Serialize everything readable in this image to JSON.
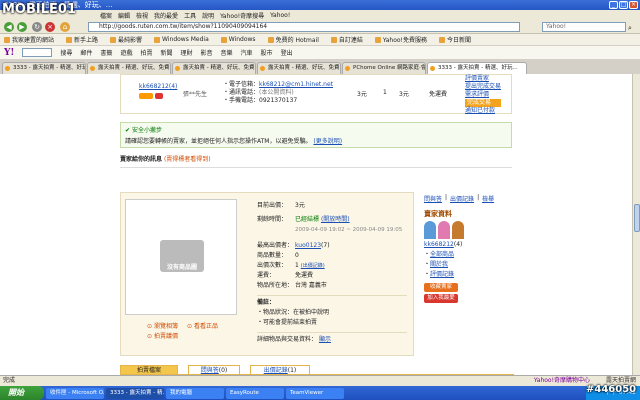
{
  "window": {
    "title": "3333 - 露天拍賣 - 精選、好玩、..."
  },
  "menubar": {
    "items": [
      "檔案",
      "編輯",
      "檢視",
      "我的最愛",
      "工具",
      "說明",
      "Yahoo!奇摩搜尋",
      "Yahoo!"
    ]
  },
  "address": {
    "url": "http://goods.ruten.com.tw/item/show?11090409094164",
    "search_placeholder": "Yahoo!"
  },
  "bookmarks": [
    "我家建置的網站",
    "新手上路",
    "最純影響",
    "Windows Media",
    "Windows",
    "免費的 Hotmail",
    "自訂連結",
    "Yahoo!免費服務",
    "今日新聞"
  ],
  "yahoo_toolbar": {
    "logo": "Y!",
    "items": [
      "搜尋",
      "郵件",
      "書籤",
      "遊戲",
      "拍賣",
      "新聞",
      "理財",
      "影音",
      "音樂",
      "汽車",
      "股市",
      "登出"
    ]
  },
  "tabs": [
    "3333 - 露天拍賣 - 精選、好玩...",
    "露天拍賣 - 精選、好玩、免費、安全",
    "露天拍賣 - 精選、好玩、免費、安全",
    "露天拍賣 - 精選、好玩、免費、安全",
    "PChome Online 網路家庭‧會員中心",
    "3333 - 露天拍賣 - 精選、好玩..."
  ],
  "seller_row": {
    "nickname": "kk668212",
    "nickname_score": "(4)",
    "name": "張**先生",
    "email_label": "電子信箱：",
    "email": "kk68212@cm1.hinet.net",
    "phone_label": "通訊電話：",
    "phone": "(本公開資料)",
    "mobile_label": "手機電話：",
    "mobile": "0921370137",
    "qty": "3元",
    "qty2": "1",
    "price": "3元",
    "shipping": "免運費",
    "links": [
      "評價賣家",
      "提出完成交易",
      "需求評價",
      "完成交易",
      "通知已付款"
    ]
  },
  "safety": {
    "title": "安全小撇步",
    "text": "請確認您要轉帳的賣家，並拒絕任何人指示您操作ATM，以避免受騙。",
    "link": "(更多說明)"
  },
  "seller_message": {
    "label": "賣家給你的訊息",
    "link": "(賣得標者看得到)"
  },
  "product": {
    "no_image_text": "沒有商品圖",
    "current_price_label": "目前出價：",
    "current_price": "3元",
    "remaining_label": "剩餘時間：",
    "remaining": "已經結標",
    "remaining_link": "(開放時間)",
    "time_range": "2009-04-09 19:02 ~ 2009-04-09 19:05",
    "top_bidder_label": "最高出價者：",
    "top_bidder": "kuo0123",
    "top_bidder_score": "(7)",
    "qty_label": "商品數量：",
    "qty": "0",
    "bid_count_label": "出價次數：",
    "bid_count": "1",
    "bid_count_link": "(出價記錄)",
    "shipping_label": "運費：",
    "shipping": "免運費",
    "location_label": "物品所在地：",
    "location": "台灣 嘉義市",
    "notes_label": "備註：",
    "notes": [
      "物品狀況：在被拍中說明",
      "可能會提前結束拍賣"
    ],
    "detail_label": "詳細物品與交易資料：",
    "detail_link": "顯示",
    "image_links": [
      "瀏覽相簿",
      "看看正品",
      "拍賣議價"
    ]
  },
  "sidebar": {
    "top_links": [
      "問與答",
      "出價記錄",
      "檢舉"
    ],
    "title": "賣家資料",
    "nickname": "kk668212",
    "score": "(4)",
    "links": [
      "全部商品",
      "關於我",
      "評價記錄"
    ],
    "buttons": [
      "收藏賣家",
      "加入我最愛"
    ]
  },
  "bottom_tabs": [
    {
      "label": "拍賣檔案",
      "count": ""
    },
    {
      "label": "問與答",
      "count": "(0)"
    },
    {
      "label": "出價記錄",
      "count": "(1)"
    }
  ],
  "status": {
    "text": "完成",
    "right": "Yahoo!奇摩購物中心",
    "right2": "露天拍賣網"
  },
  "taskbar": {
    "start": "開始",
    "items": [
      "收件匣 - Microsoft O...",
      "3333 - 露天拍賣 - 精...",
      "我的電腦",
      "EasyRoute",
      "TeamViewer"
    ],
    "clock": "下午 07:42"
  },
  "watermarks": {
    "top_left": "MOBILE01",
    "bottom_right": "#446050"
  }
}
